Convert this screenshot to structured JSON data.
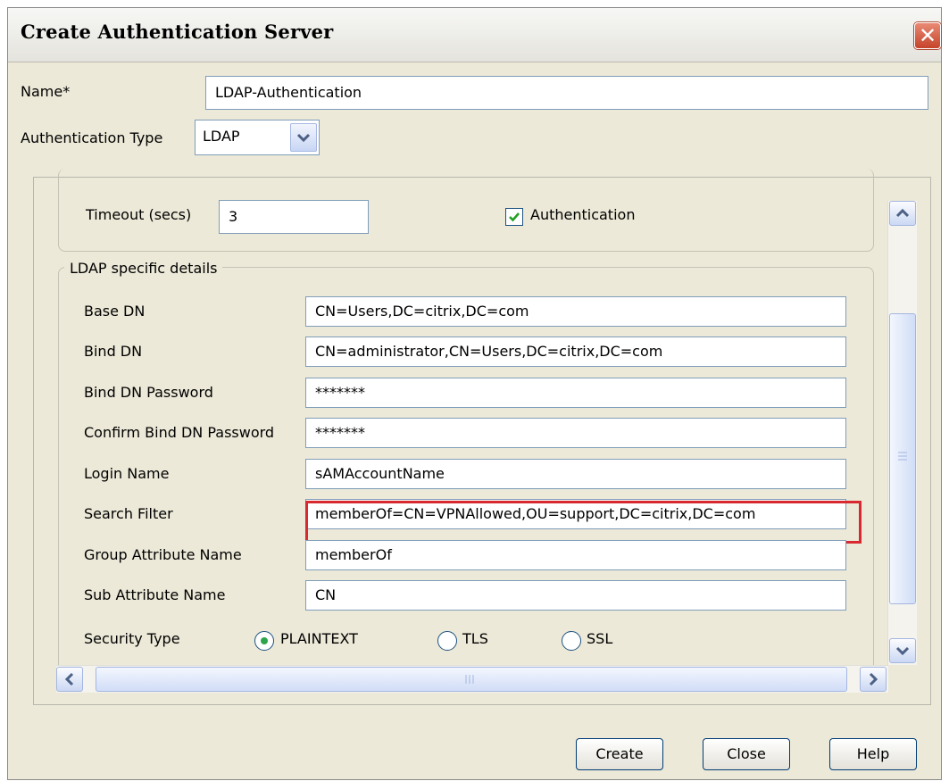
{
  "dialog": {
    "title": "Create Authentication Server",
    "close_glyph": "✕"
  },
  "form": {
    "name_label": "Name*",
    "name_value": "LDAP-Authentication",
    "auth_type_label": "Authentication Type",
    "auth_type_value": "LDAP"
  },
  "timeout": {
    "label": "Timeout (secs)",
    "value": "3",
    "auth_checkbox_label": "Authentication",
    "auth_checked": true
  },
  "ldap": {
    "legend": "LDAP specific details",
    "fields": [
      {
        "label": "Base DN",
        "value": "CN=Users,DC=citrix,DC=com"
      },
      {
        "label": "Bind DN",
        "value": "CN=administrator,CN=Users,DC=citrix,DC=com"
      },
      {
        "label": "Bind DN Password",
        "value": "*******"
      },
      {
        "label": "Confirm Bind DN Password",
        "value": "*******"
      },
      {
        "label": "Login Name",
        "value": "sAMAccountName"
      },
      {
        "label": "Search Filter",
        "value": "memberOf=CN=VPNAllowed,OU=support,DC=citrix,DC=com"
      },
      {
        "label": "Group Attribute Name",
        "value": "memberOf"
      },
      {
        "label": "Sub Attribute Name",
        "value": "CN"
      }
    ],
    "security_type_label": "Security Type",
    "security_options": [
      "PLAINTEXT",
      "TLS",
      "SSL"
    ],
    "security_selected": "PLAINTEXT"
  },
  "buttons": {
    "create": "Create",
    "close": "Close",
    "help": "Help"
  },
  "colors": {
    "highlight": "#d7292f",
    "dialog_bg": "#ece9d8",
    "field_border": "#7f9db9"
  },
  "icons": {
    "dropdown": "chevron-down-icon",
    "scroll_up": "arrow-up-icon",
    "scroll_down": "arrow-down-icon",
    "scroll_left": "arrow-left-icon",
    "scroll_right": "arrow-right-icon",
    "check": "checkmark-icon",
    "close": "close-icon"
  }
}
